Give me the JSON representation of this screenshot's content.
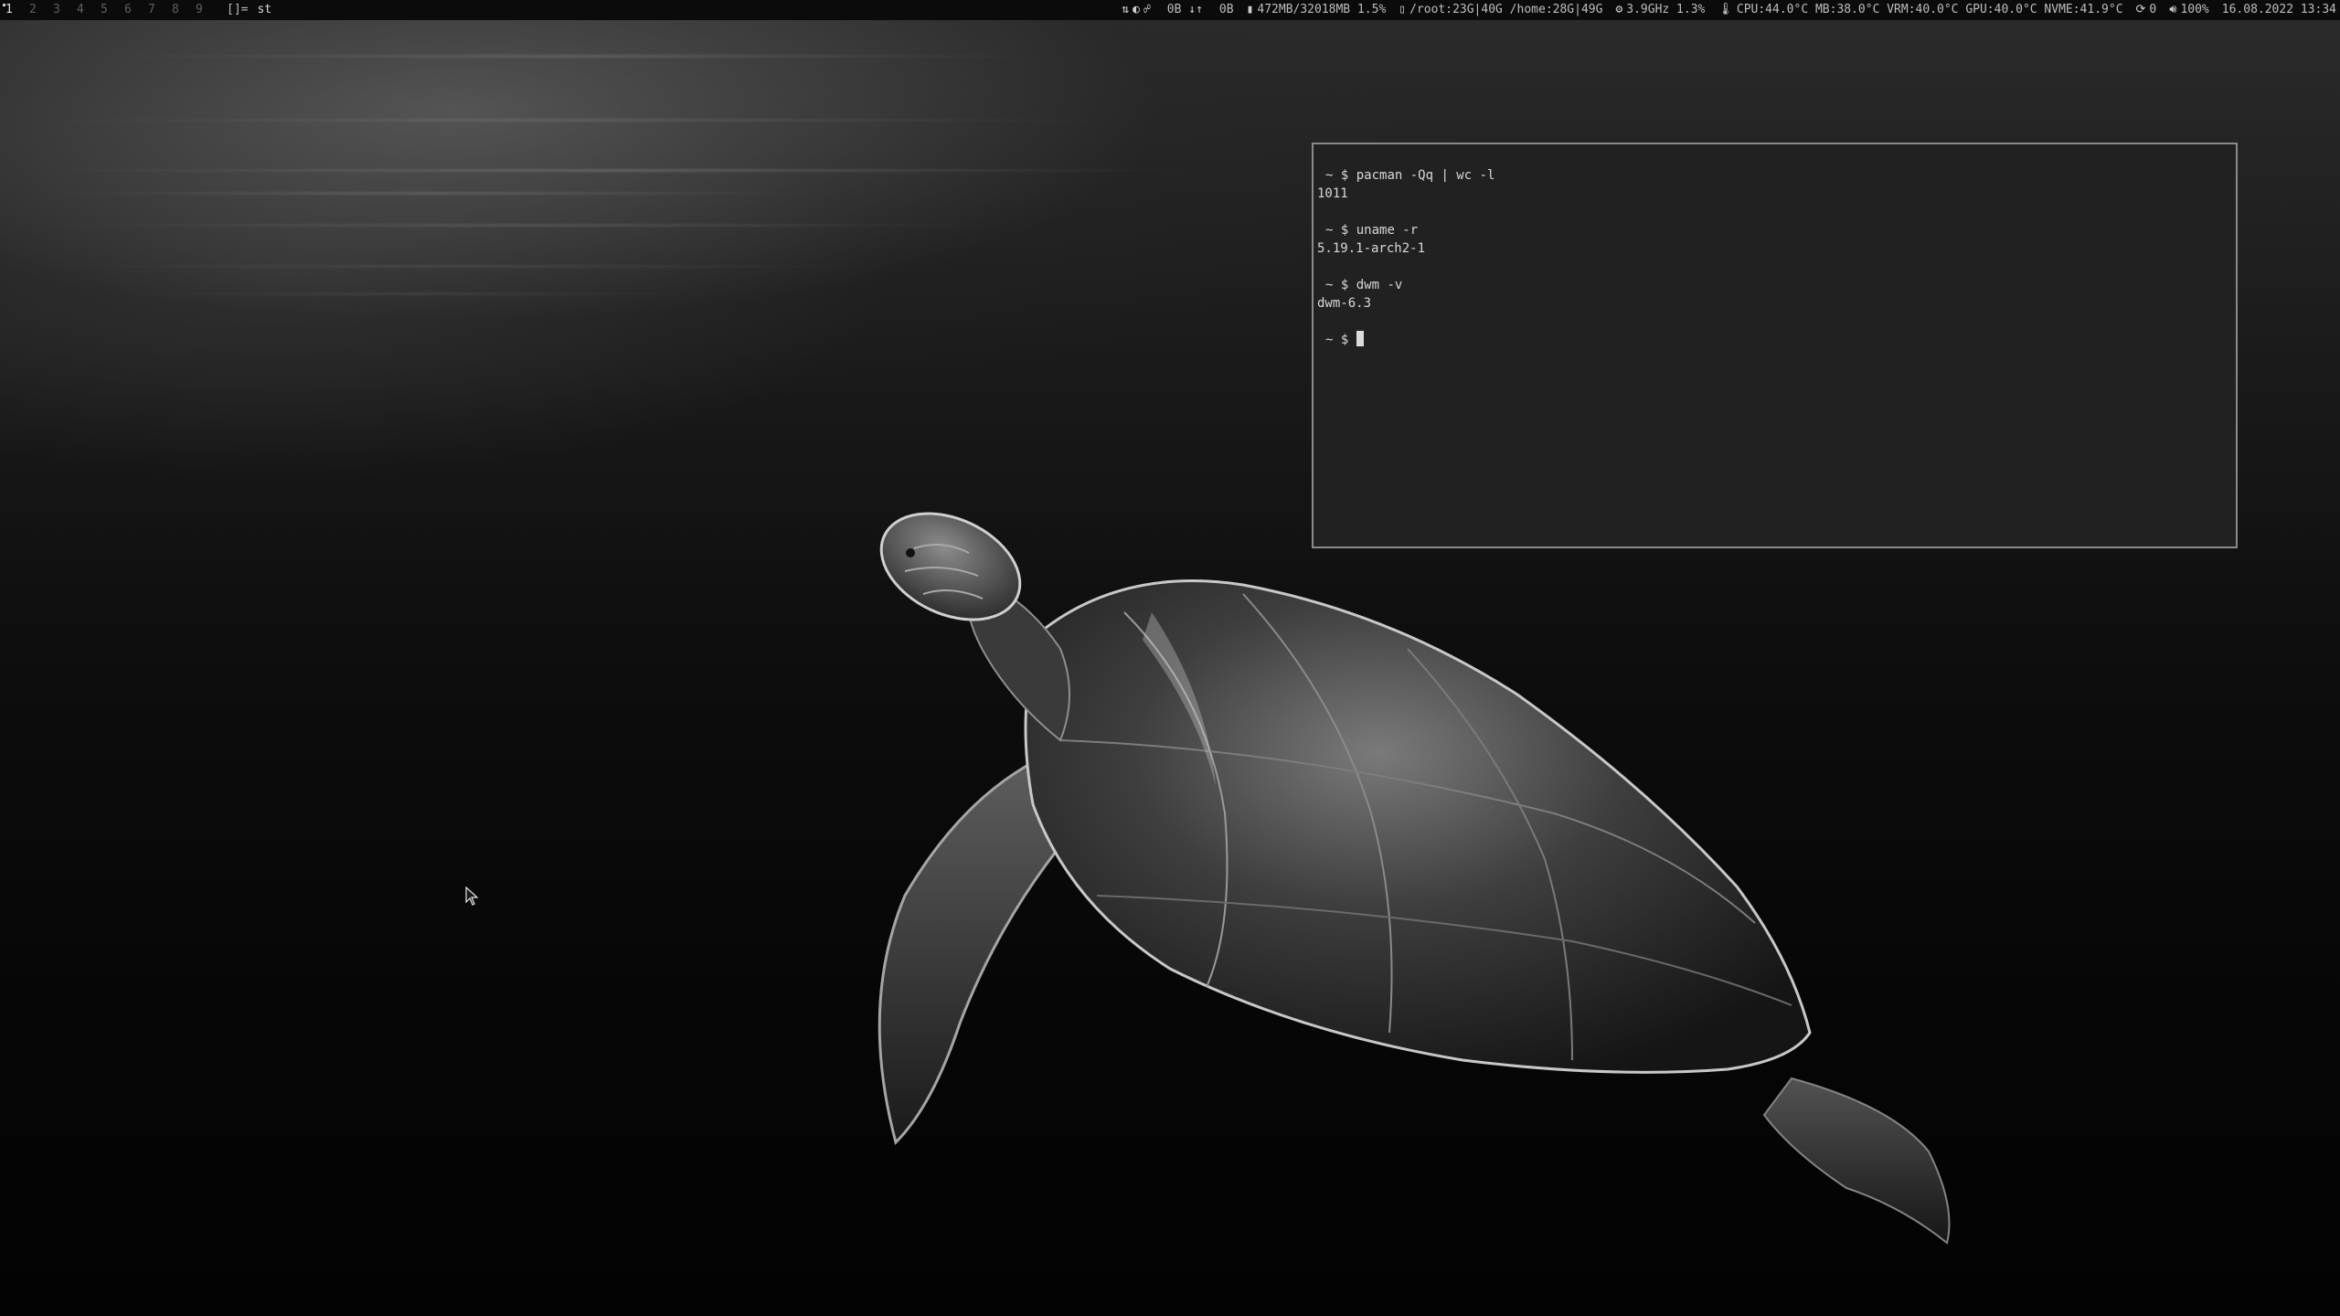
{
  "bar": {
    "tags": [
      "1",
      "2",
      "3",
      "4",
      "5",
      "6",
      "7",
      "8",
      "9"
    ],
    "active_tag": 0,
    "layout": "[]=",
    "window_title": "st",
    "status": {
      "net_down": "0B",
      "net_up": "0B",
      "memory": "472MB/32018MB 1.5%",
      "disk": "/root:23G|40G /home:28G|49G",
      "cpu_freq": "3.9GHz 1.3%",
      "temps": "CPU:44.0°C MB:38.0°C VRM:40.0°C GPU:40.0°C NVME:41.9°C",
      "updates": "0",
      "volume": "100%",
      "datetime": "16.08.2022 13:34"
    }
  },
  "terminal": {
    "lines": [
      {
        "type": "cmd",
        "prompt": "~ $",
        "text": "pacman -Qq | wc -l"
      },
      {
        "type": "out",
        "text": "1011"
      },
      {
        "type": "gap"
      },
      {
        "type": "cmd",
        "prompt": "~ $",
        "text": "uname -r"
      },
      {
        "type": "out",
        "text": "5.19.1-arch2-1"
      },
      {
        "type": "gap"
      },
      {
        "type": "cmd",
        "prompt": "~ $",
        "text": "dwm -v"
      },
      {
        "type": "out",
        "text": "dwm-6.3"
      },
      {
        "type": "gap"
      },
      {
        "type": "cmd",
        "prompt": "~ $",
        "text": "",
        "cursor": true
      }
    ]
  },
  "colors": {
    "bar_bg": "#0b0b0b",
    "terminal_bg": "#212121",
    "terminal_border": "#8a8a8a",
    "text": "#d8d8d8"
  }
}
